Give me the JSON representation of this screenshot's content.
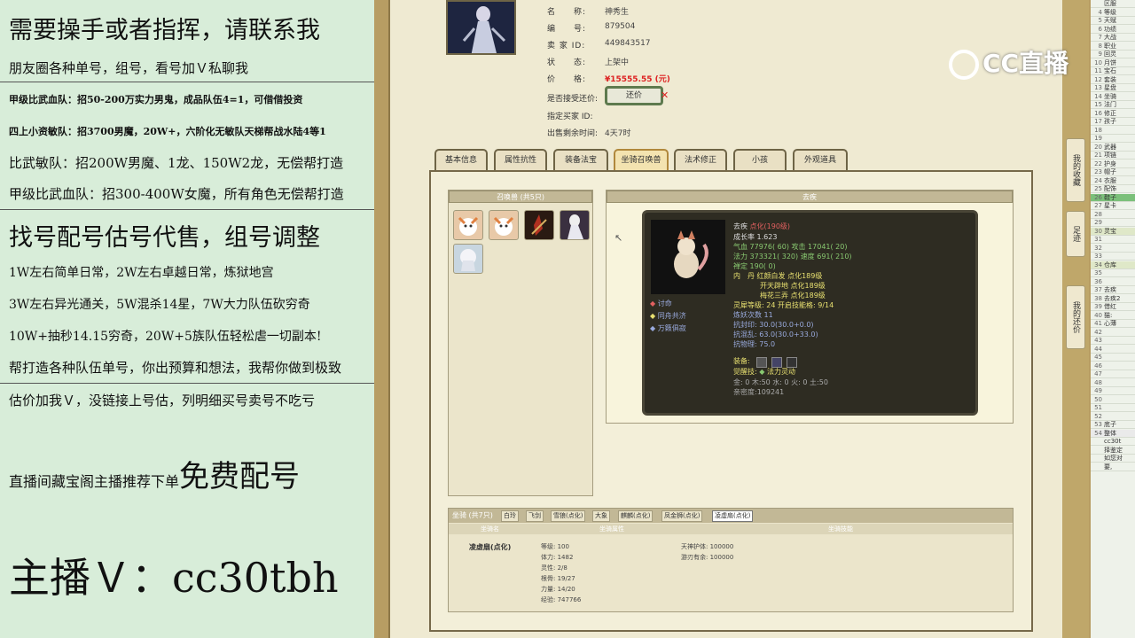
{
  "promo": {
    "l1": "需要操手或者指挥，请联系我",
    "l2": "朋友圈各种单号，组号，看号加Ｖ私聊我",
    "l3": "甲级比武血队：招50-200万实力男鬼，成品队伍4=1，可借借投资",
    "l4": "四上小资敏队：招3700男魔，20W+，六阶化无敏队天梯帮战水陆4等1",
    "l5": "比武敏队：招200W男魔、1龙、150W2龙，无偿帮打造",
    "l6": "甲级比武血队：招300-400W女魔，所有角色无偿帮打造",
    "l7": "找号配号估号代售，组号调整",
    "l8": "1W左右简单日常，2W左右卓越日常，炼狱地宫",
    "l9": "3W左右异光通关，5W混杀14星，7W大力队伍砍穷奇",
    "l10": "10W+抽秒14.15穷奇，20W+5族队伍轻松虐一切副本!",
    "l11": "帮打造各种队伍单号，你出预算和想法，我帮你做到极致",
    "l12": "估价加我Ｖ，没链接上号估，列明细买号卖号不吃亏",
    "l13a": "直播间藏宝阁主播推荐下单",
    "l13b": "免费配号",
    "l14": "主播Ｖ：cc30tbh"
  },
  "listing": {
    "name_label": "名　　称:",
    "name": "神秀生",
    "id_label": "编　　号:",
    "id": "879504",
    "seller_label": "卖 家 ID:",
    "seller": "449843517",
    "status_label": "状　　态:",
    "status": "上架中",
    "price_label": "价　　格:",
    "price": "¥15555.55 (元)",
    "bargain_label": "是否接受还价:",
    "bargain_btn": "还价",
    "buyer_label": "指定买家 ID:",
    "remain_label": "出售剩余时间:",
    "remain": "4天7时"
  },
  "tabs": [
    "基本信息",
    "属性抗性",
    "装备法宝",
    "坐骑召唤兽",
    "法术修正",
    "小孩",
    "外观道具"
  ],
  "summon": {
    "list_header": "召唤兽 (共5只)",
    "detail_header": "去疾",
    "name": "去疾",
    "name_suffix": "点化(190级)",
    "growth": "成长率 1.623",
    "hp": "气血 77976( 60)",
    "atk": "攻击 17041( 20)",
    "mp": "法力 373321( 320)",
    "spd": "速度 691( 210)",
    "def": "禅定 190( 0)",
    "core1": "内　丹 红颜白发 点化189级",
    "core2": "开天辟地 点化189级",
    "core3": "梅花三弄 点化189级",
    "lingxi": "灵犀等级: 24 开启技能格: 9/14",
    "reborn": "炼妖次数 11",
    "res1": "抗封印: 30.0(30.0+0.0)",
    "res2": "抗混乱: 63.0(30.0+33.0)",
    "res3": "抗物理: 75.0",
    "skills": [
      "讨命",
      "同舟共济",
      "万籁俱寂"
    ],
    "equip_label": "装备:",
    "awake_label": "觉醒技:",
    "awake": "法力灵动",
    "elements": "金: 0 木:50 水: 0 火: 0 土:50",
    "wuxing": "亲密度:109241"
  },
  "mount": {
    "header": "坐骑 (共7只)",
    "tabs": [
      "白玲",
      "飞剑",
      "雪狼(点化)",
      "大象",
      "麒麟(点化)",
      "凤金狮(点化)",
      "凌虚扇(点化)"
    ],
    "col1": "坐骑名",
    "col2": "坐骑属性",
    "col3": "坐骑技能",
    "name": "凌虚扇(点化)",
    "stats": [
      "等级: 100",
      "体力: 1482",
      "灵性: 2/8",
      "根骨: 19/27",
      "力量: 14/20",
      "经验: 747766"
    ],
    "skills": [
      "天神护体: 100000",
      "游刃有余: 100000"
    ]
  },
  "side_buttons": [
    "我的收藏",
    "足迹",
    "我的还价"
  ],
  "watermark": "CC直播",
  "right_rows": [
    {
      "n": "",
      "t": "区服"
    },
    {
      "n": "4",
      "t": "等级"
    },
    {
      "n": "5",
      "t": "天赋"
    },
    {
      "n": "6",
      "t": "功绩"
    },
    {
      "n": "7",
      "t": "大战"
    },
    {
      "n": "8",
      "t": "职业"
    },
    {
      "n": "9",
      "t": "回灵"
    },
    {
      "n": "10",
      "t": "月饼"
    },
    {
      "n": "11",
      "t": "宝石"
    },
    {
      "n": "12",
      "t": "套装"
    },
    {
      "n": "13",
      "t": "星盘"
    },
    {
      "n": "14",
      "t": "坐骑"
    },
    {
      "n": "15",
      "t": "法门"
    },
    {
      "n": "16",
      "t": "修正"
    },
    {
      "n": "17",
      "t": "孩子"
    },
    {
      "n": "18",
      "t": ""
    },
    {
      "n": "19",
      "t": ""
    },
    {
      "n": "20",
      "t": "武器"
    },
    {
      "n": "21",
      "t": "项链"
    },
    {
      "n": "22",
      "t": "护身"
    },
    {
      "n": "23",
      "t": "帽子"
    },
    {
      "n": "24",
      "t": "衣服"
    },
    {
      "n": "25",
      "t": "配饰"
    },
    {
      "n": "26",
      "t": "鞋子"
    },
    {
      "n": "27",
      "t": "星卡"
    },
    {
      "n": "28",
      "t": ""
    },
    {
      "n": "29",
      "t": ""
    },
    {
      "n": "30",
      "t": "灵宝"
    },
    {
      "n": "31",
      "t": ""
    },
    {
      "n": "32",
      "t": ""
    },
    {
      "n": "33",
      "t": ""
    },
    {
      "n": "34",
      "t": "仓库"
    },
    {
      "n": "35",
      "t": ""
    },
    {
      "n": "36",
      "t": ""
    },
    {
      "n": "37",
      "t": "去疾"
    },
    {
      "n": "38",
      "t": "去疾2"
    },
    {
      "n": "39",
      "t": "借红"
    },
    {
      "n": "40",
      "t": "猫:"
    },
    {
      "n": "41",
      "t": "心薄"
    },
    {
      "n": "42",
      "t": ""
    },
    {
      "n": "43",
      "t": ""
    },
    {
      "n": "44",
      "t": ""
    },
    {
      "n": "45",
      "t": ""
    },
    {
      "n": "46",
      "t": ""
    },
    {
      "n": "47",
      "t": ""
    },
    {
      "n": "48",
      "t": ""
    },
    {
      "n": "49",
      "t": ""
    },
    {
      "n": "50",
      "t": ""
    },
    {
      "n": "51",
      "t": ""
    },
    {
      "n": "52",
      "t": ""
    },
    {
      "n": "53",
      "t": "底子"
    },
    {
      "n": "54",
      "t": "整体"
    },
    {
      "n": "",
      "t": "cc30t"
    },
    {
      "n": "",
      "t": "择鉴定"
    },
    {
      "n": "",
      "t": "如您对"
    },
    {
      "n": "",
      "t": "要,"
    }
  ]
}
